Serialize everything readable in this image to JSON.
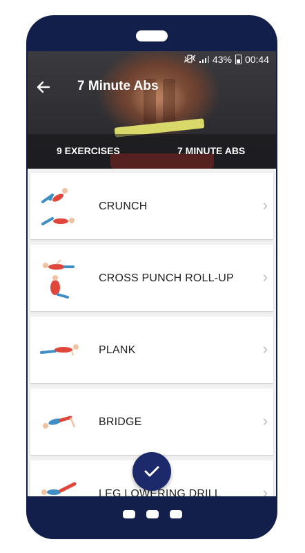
{
  "status_bar": {
    "battery": "43%",
    "time": "00:44",
    "icons": [
      "mute-vibrate-icon",
      "signal-icon",
      "battery-icon"
    ]
  },
  "header": {
    "title": "7 Minute Abs",
    "back_icon": "back-arrow-icon",
    "exercise_count": "9 EXERCISES",
    "duration": "7 MINUTE ABS"
  },
  "exercises": [
    {
      "name": "CRUNCH",
      "icon": "crunch-figure"
    },
    {
      "name": "CROSS PUNCH ROLL-UP",
      "icon": "cross-punch-figure"
    },
    {
      "name": "PLANK",
      "icon": "plank-figure"
    },
    {
      "name": "BRIDGE",
      "icon": "bridge-figure"
    },
    {
      "name": "LEG LOWERING DRILL",
      "icon": "leg-lowering-figure"
    }
  ],
  "fab": {
    "icon": "check-icon"
  },
  "colors": {
    "frame": "#131f4b",
    "accent": "#1c2a6b",
    "figure_shirt": "#e0473a",
    "figure_pants": "#3f8fc6"
  }
}
